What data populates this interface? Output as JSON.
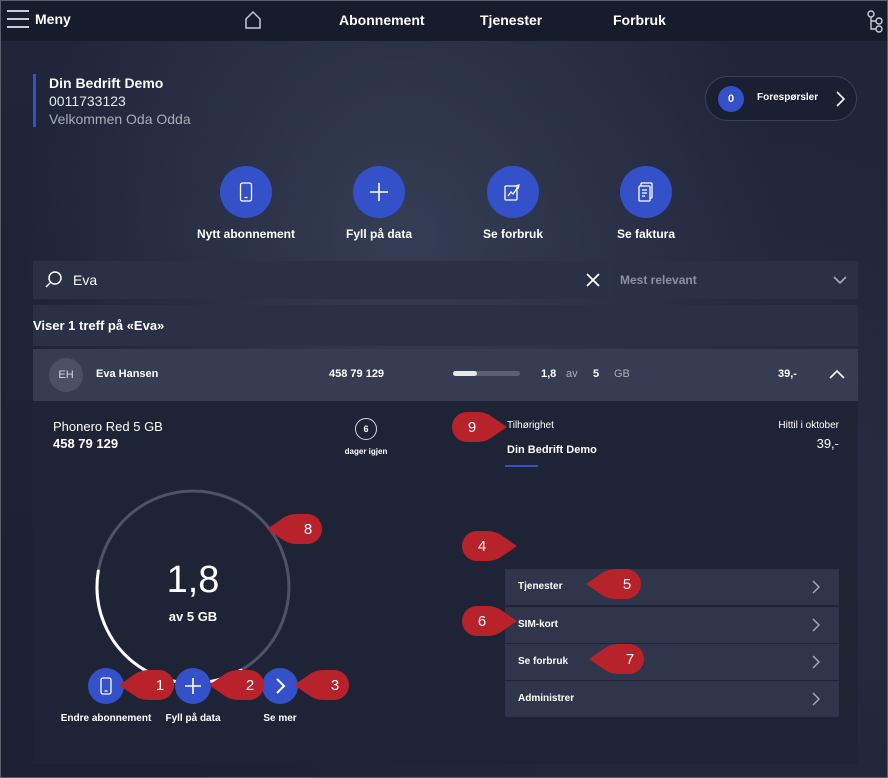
{
  "topbar": {
    "menu_label": "Meny",
    "nav": [
      "Abonnement",
      "Tjenester",
      "Forbruk"
    ]
  },
  "company": {
    "name": "Din Bedrift Demo",
    "number": "0011733123",
    "welcome": "Velkommen Oda Odda"
  },
  "requests": {
    "count": "0",
    "label": "Forespørsler"
  },
  "quick_actions": [
    {
      "label": "Nytt abonnement",
      "icon": "phone-icon"
    },
    {
      "label": "Fyll på data",
      "icon": "plus-icon"
    },
    {
      "label": "Se forbruk",
      "icon": "usage-chart-icon"
    },
    {
      "label": "Se faktura",
      "icon": "invoice-icon"
    }
  ],
  "search": {
    "value": "Eva",
    "placeholder": ""
  },
  "sort": {
    "selected": "Mest relevant"
  },
  "results_text": "Viser 1 treff på «Eva»",
  "subscription_row": {
    "initials": "EH",
    "name": "Eva Hansen",
    "number": "458 79 129",
    "used": "1,8",
    "of": "av",
    "total": "5",
    "unit": "GB",
    "used_fraction": 0.36,
    "price": "39,-"
  },
  "detail": {
    "plan_name": "Phonero Red 5 GB",
    "plan_number": "458 79 129",
    "days_left": "6",
    "days_label": "dager igjen",
    "belonging_label": "Tilhørighet",
    "belonging_value": "Din Bedrift Demo",
    "period_label": "Hittil i oktober",
    "period_amount": "39,-",
    "gauge_value": "1,8",
    "gauge_caption": "av 5 GB",
    "gauge_fraction": 0.36,
    "bottom_actions": [
      {
        "label": "Endre abonnement",
        "icon": "phone-icon"
      },
      {
        "label": "Fyll på data",
        "icon": "plus-icon"
      },
      {
        "label": "Se mer",
        "icon": "chevron-right-icon"
      }
    ],
    "services": [
      "Tjenester",
      "SIM-kort",
      "Se forbruk",
      "Administrer"
    ]
  },
  "markers": [
    "1",
    "2",
    "3",
    "4",
    "5",
    "6",
    "7",
    "8",
    "9"
  ],
  "colors": {
    "accent": "#3451c9",
    "marker": "#b8222b",
    "background": "#1f2538"
  }
}
